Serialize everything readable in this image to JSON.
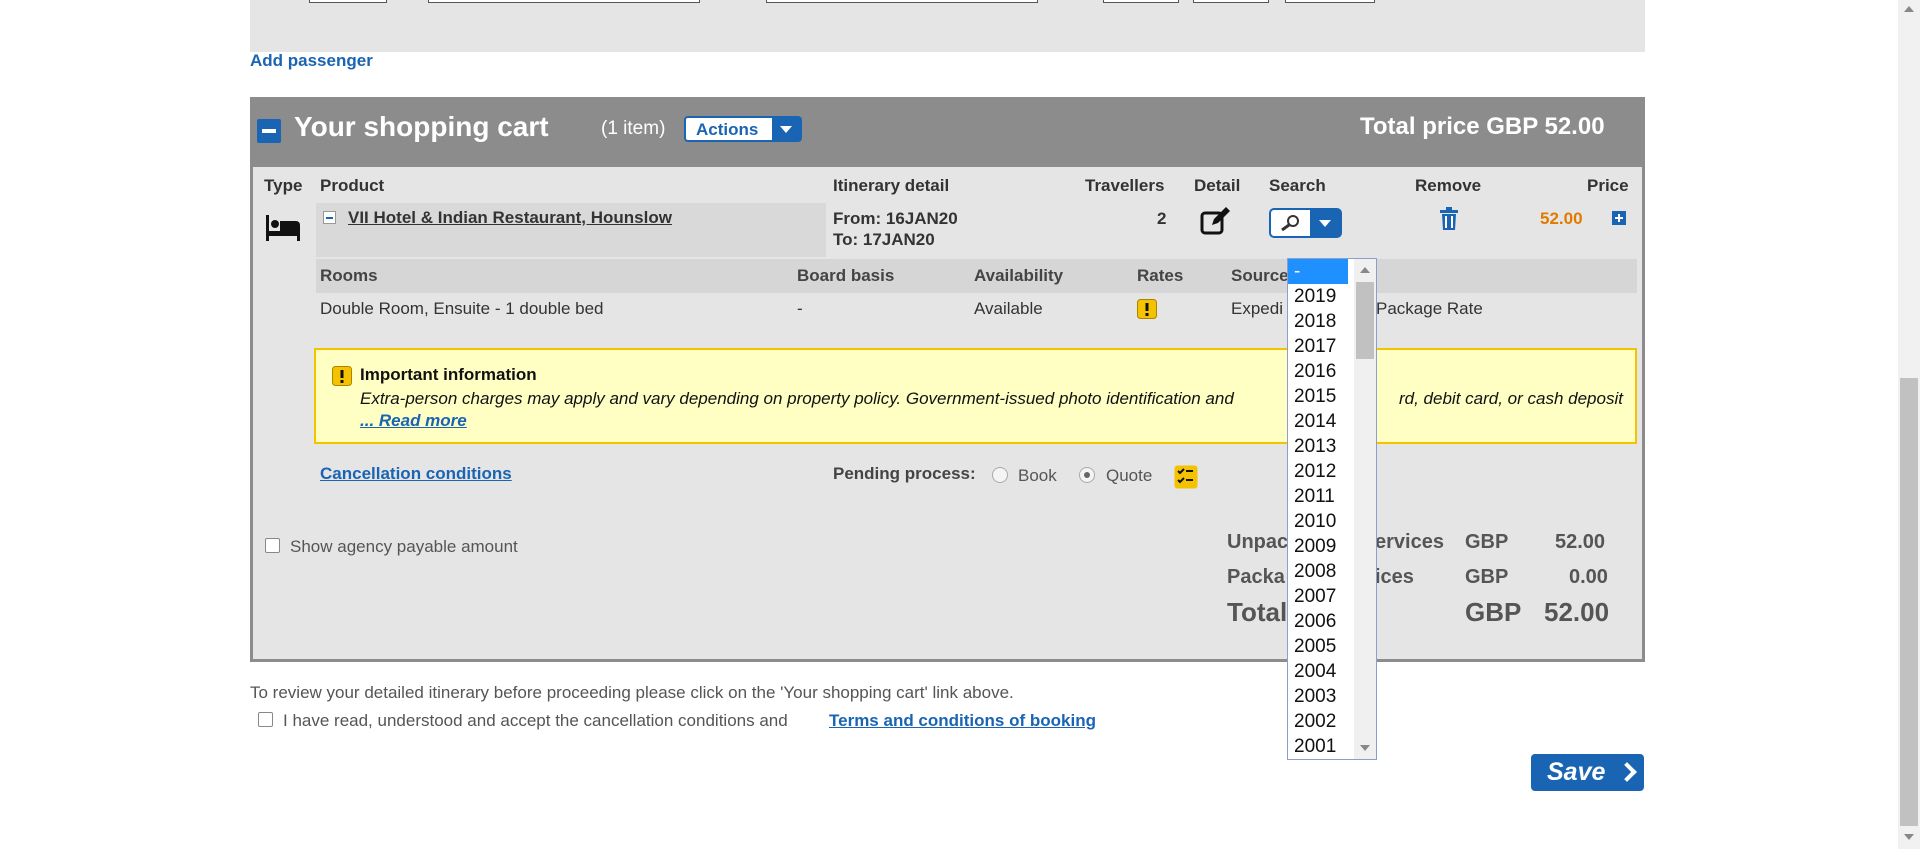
{
  "page": {
    "add_passenger": "Add passenger"
  },
  "cart": {
    "title": "Your shopping cart",
    "item_count": "(1 item)",
    "actions_label": "Actions",
    "total_price": "Total price GBP 52.00",
    "columns": {
      "type": "Type",
      "product": "Product",
      "itinerary": "Itinerary detail",
      "travellers": "Travellers",
      "detail": "Detail",
      "search": "Search",
      "remove": "Remove",
      "price": "Price"
    },
    "item": {
      "product": "VII Hotel & Indian Restaurant, Hounslow",
      "from": "From: 16JAN20",
      "to": "To: 17JAN20",
      "travellers": "2",
      "price": "52.00"
    },
    "rooms_headers": {
      "rooms": "Rooms",
      "board_basis": "Board basis",
      "availability": "Availability",
      "rates": "Rates",
      "source": "Source"
    },
    "room_row": {
      "room": "Double Room, Ensuite - 1 double bed",
      "board_basis": "-",
      "availability": "Available",
      "source": "Expedi",
      "rate_type": "Package Rate"
    },
    "info": {
      "title": "Important information",
      "text_before": "Extra-person charges may apply and vary depending on property policy. Government-issued photo identification and",
      "text_after": "rd, debit card, or cash deposit",
      "read_more": "... Read more"
    },
    "cancellation_link": "Cancellation conditions",
    "pending": {
      "label": "Pending process:",
      "book": "Book",
      "quote": "Quote",
      "selected": "Quote"
    },
    "agency_payable_label": "Show agency payable amount",
    "summary": {
      "unpackaged_left": "Unpac",
      "unpackaged_right": "ervices",
      "unpackaged_currency": "GBP",
      "unpackaged_amount": "52.00",
      "packaged_left": "Packa",
      "packaged_right": "ices",
      "packaged_currency": "GBP",
      "packaged_amount": "0.00",
      "total_label": "Total",
      "total_currency": "GBP",
      "total_amount": "52.00"
    }
  },
  "footer": {
    "review_note": "To review your detailed itinerary before proceeding please click on the 'Your shopping cart' link above.",
    "accept_text": "I have read, understood and accept the cancellation conditions and",
    "terms_link": "Terms and conditions of booking",
    "save_label": "Save"
  },
  "year_dropdown": {
    "selected": "-",
    "options": [
      "-",
      "2019",
      "2018",
      "2017",
      "2016",
      "2015",
      "2014",
      "2013",
      "2012",
      "2011",
      "2010",
      "2009",
      "2008",
      "2007",
      "2006",
      "2005",
      "2004",
      "2003",
      "2002",
      "2001"
    ]
  },
  "colors": {
    "accent": "#1a64b4",
    "price": "#e07b00",
    "warning_bg": "#ffffc4",
    "header_gray": "#8c8c8c"
  }
}
